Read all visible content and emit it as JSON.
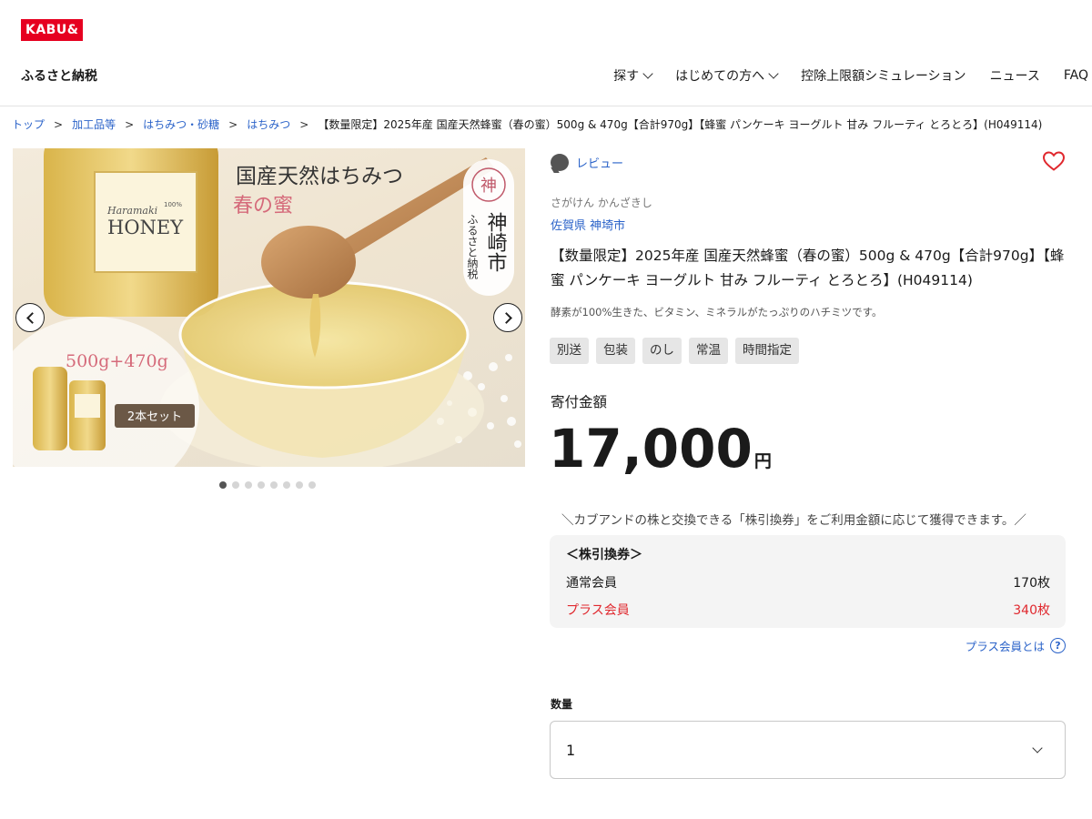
{
  "header": {
    "logo": "KABU&",
    "site_name": "ふるさと納税",
    "nav": [
      {
        "label": "探す",
        "has_dropdown": true
      },
      {
        "label": "はじめての方へ",
        "has_dropdown": true
      },
      {
        "label": "控除上限額シミュレーション",
        "has_dropdown": false
      },
      {
        "label": "ニュース",
        "has_dropdown": false
      },
      {
        "label": "FAQ",
        "has_dropdown": false
      }
    ]
  },
  "breadcrumb": {
    "links": [
      "トップ",
      "加工品等",
      "はちみつ・砂糖",
      "はちみつ"
    ],
    "separator": ">",
    "current": "【数量限定】2025年産 国産天然蜂蜜（春の蜜）500g & 470g【合計970g】【蜂蜜 パンケーキ ヨーグルト 甘み フルーティ とろとろ】(H049114)"
  },
  "gallery": {
    "image_texts": {
      "headline": "国産天然はちみつ",
      "subhead": "春の蜜",
      "city": "神崎市",
      "city_sub": "ふるさと納税",
      "seal": "神",
      "label_brand": "Haramaki",
      "label_small": "100%",
      "label_main": "HONEY",
      "weights": "500g+470g",
      "set_badge": "2本セット"
    },
    "slide_count": 8,
    "active_slide": 1
  },
  "product": {
    "review_label": "レビュー",
    "municipality_kana": "さがけん かんざきし",
    "municipality": "佐賀県 神埼市",
    "title": "【数量限定】2025年産 国産天然蜂蜜（春の蜜）500g & 470g【合計970g】【蜂蜜 パンケーキ ヨーグルト 甘み フルーティ とろとろ】(H049114)",
    "description": "酵素が100%生きた、ビタミン、ミネラルがたっぷりのハチミツです。",
    "tags": [
      "別送",
      "包装",
      "のし",
      "常温",
      "時間指定"
    ],
    "price_label": "寄付金額",
    "price": "17,000",
    "price_unit": "円",
    "exchange_note": "＼カブアンドの株と交換できる「株引換券」をご利用金額に応じて獲得できます。／",
    "stock": {
      "title": "＜株引換券＞",
      "normal_label": "通常会員",
      "normal_value": "170枚",
      "plus_label": "プラス会員",
      "plus_value": "340枚"
    },
    "plus_link": "プラス会員とは",
    "quantity_label": "数量",
    "quantity_value": "1"
  },
  "colors": {
    "brand_red": "#e60020",
    "link_blue": "#2b63c9",
    "plus_red": "#e0282e",
    "heart_red": "#e0282e"
  },
  "icons": [
    "chevron-down-icon",
    "chevron-left-icon",
    "chevron-right-icon",
    "speech-bubble-icon",
    "heart-icon",
    "question-circle-icon"
  ]
}
